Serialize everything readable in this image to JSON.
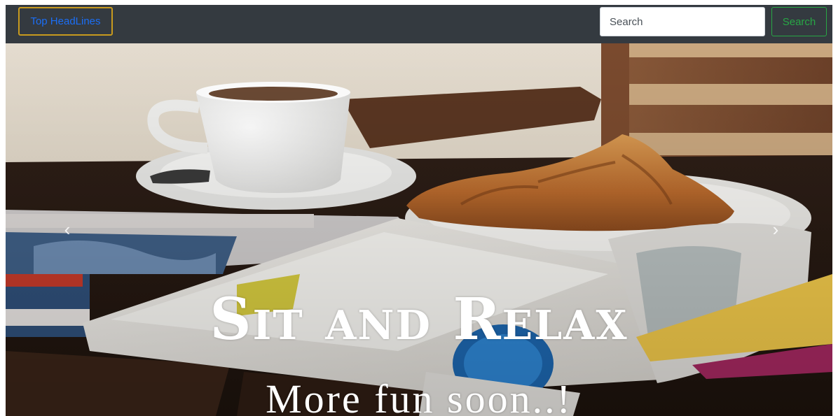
{
  "navbar": {
    "brand_label": "Top HeadLines",
    "search_placeholder": "Search",
    "search_button_label": "Search",
    "colors": {
      "background": "#343a40",
      "brand_text": "#1b6ef5",
      "brand_border": "#c89a1e",
      "search_button": "#28a745"
    }
  },
  "carousel": {
    "prev_icon": "chevron-left-icon",
    "next_icon": "chevron-right-icon",
    "prev_glyph": "‹",
    "next_glyph": "›",
    "caption_title": "Sit and Relax",
    "caption_subtitle": "More fun soon..!"
  }
}
